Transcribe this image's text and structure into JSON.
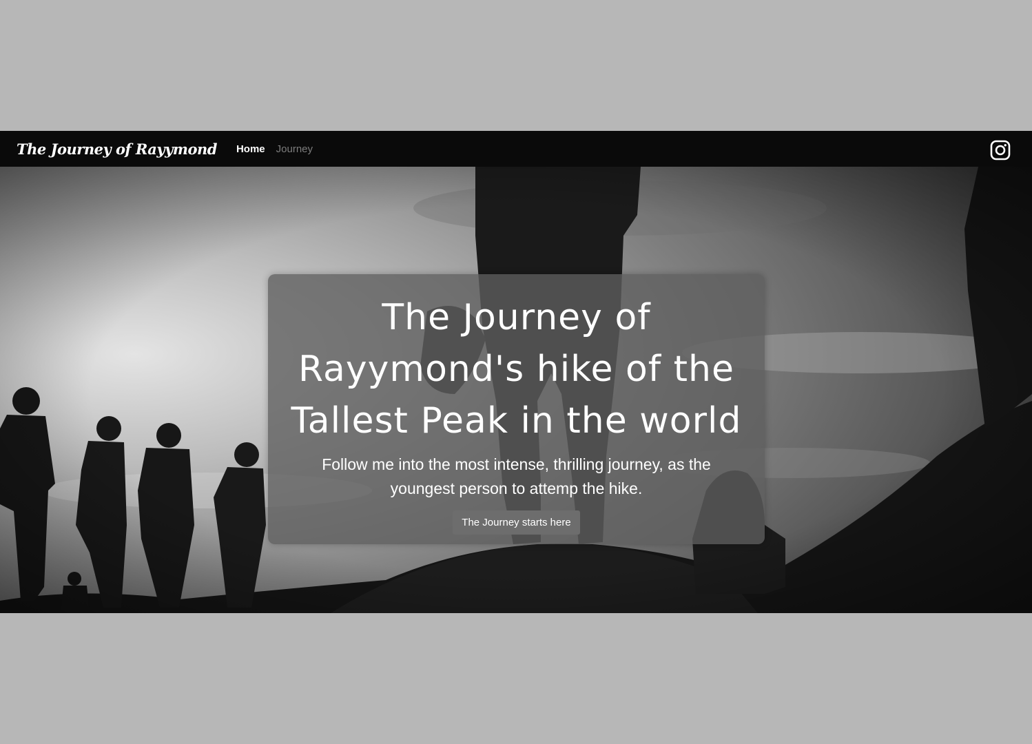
{
  "navbar": {
    "brand": "The Journey of Rayymond",
    "links": [
      {
        "label": "Home",
        "active": true
      },
      {
        "label": "Journey",
        "active": false
      }
    ],
    "social_icon": "instagram-icon"
  },
  "hero": {
    "title": "The Journey of Rayymond's hike of the Tallest Peak in the world",
    "subtitle": "Follow me into the most intense, thrilling journey, as the youngest person to attemp the hike.",
    "cta_label": "The Journey starts here"
  },
  "colors": {
    "page_background": "#b7b7b7",
    "navbar_background": "#0a0a0a",
    "card_background": "#5f5f5f",
    "button_background": "#6d6d6d",
    "text": "#ffffff"
  }
}
